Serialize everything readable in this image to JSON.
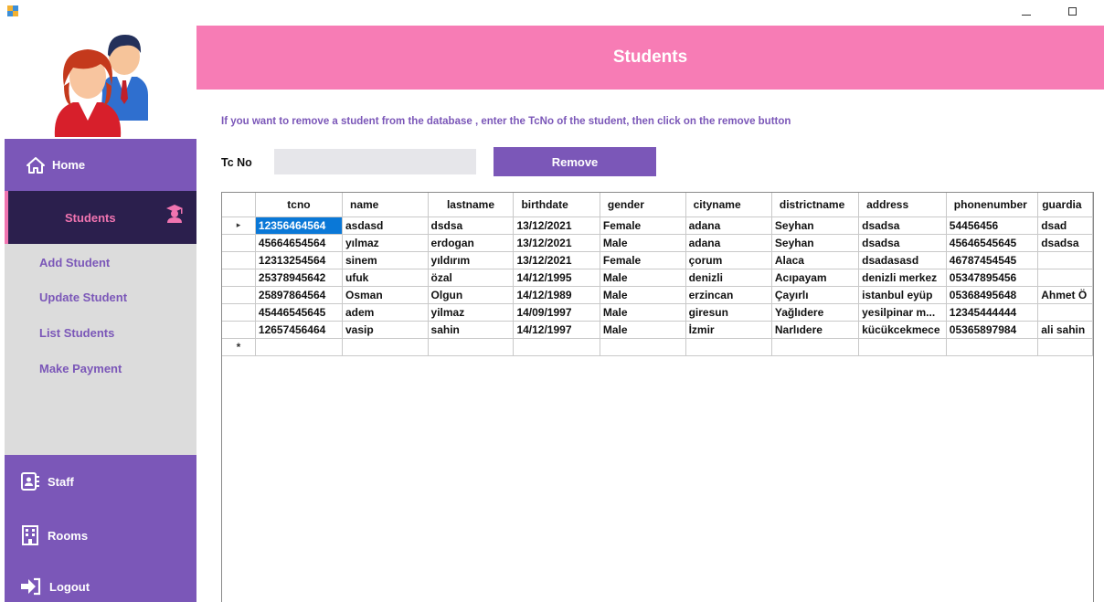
{
  "header": {
    "title": "Students"
  },
  "instructions": "If you want to remove a student from the database , enter the TcNo of the student, then click on the remove button",
  "form": {
    "tc_label": "Tc No",
    "tc_value": "",
    "remove_label": "Remove"
  },
  "sidebar": {
    "home": "Home",
    "students": "Students",
    "sub_items": [
      "Add Student",
      "Update Student",
      "List Students",
      "Make Payment"
    ],
    "bottom_items": [
      "Staff",
      "Rooms",
      "Logout"
    ]
  },
  "grid": {
    "columns": [
      "tcno",
      "name",
      "lastname",
      "birthdate",
      "gender",
      "cityname",
      "districtname",
      "address",
      "phonenumber",
      "guardia"
    ],
    "rows": [
      [
        "12356464564",
        "asdasd",
        "dsdsa",
        "13/12/2021",
        "Female",
        "adana",
        "Seyhan",
        "dsadsa",
        "54456456",
        "dsad"
      ],
      [
        "45664654564",
        "yılmaz",
        "erdogan",
        "13/12/2021",
        "Male",
        "adana",
        "Seyhan",
        "dsadsa",
        "45646545645",
        "dsadsa"
      ],
      [
        "12313254564",
        "sinem",
        "yıldırım",
        "13/12/2021",
        "Female",
        "çorum",
        "Alaca",
        "dsadasasd",
        "46787454545",
        ""
      ],
      [
        "25378945642",
        "ufuk",
        "özal",
        "14/12/1995",
        "Male",
        "denizli",
        "Acıpayam",
        "denizli merkez",
        "05347895456",
        ""
      ],
      [
        "25897864564",
        "Osman",
        "Olgun",
        "14/12/1989",
        "Male",
        "erzincan",
        "Çayırlı",
        "istanbul eyüp",
        "05368495648",
        "Ahmet Ö"
      ],
      [
        "45446545645",
        "adem",
        "yilmaz",
        "14/09/1997",
        "Male",
        "giresun",
        "Yağlıdere",
        "yesilpinar m...",
        "12345444444",
        ""
      ],
      [
        "12657456464",
        "vasip",
        "sahin",
        "14/12/1997",
        "Male",
        "İzmir",
        "Narlıdere",
        "kücükcekmece",
        "05365897984",
        "ali sahin"
      ]
    ],
    "current_row_marker": "▸",
    "new_row_marker": "*"
  },
  "colors": {
    "accent": "#7b57b8",
    "header": "#f77cb5",
    "selected": "#0a78d7",
    "active_nav": "#2b1f4d"
  }
}
